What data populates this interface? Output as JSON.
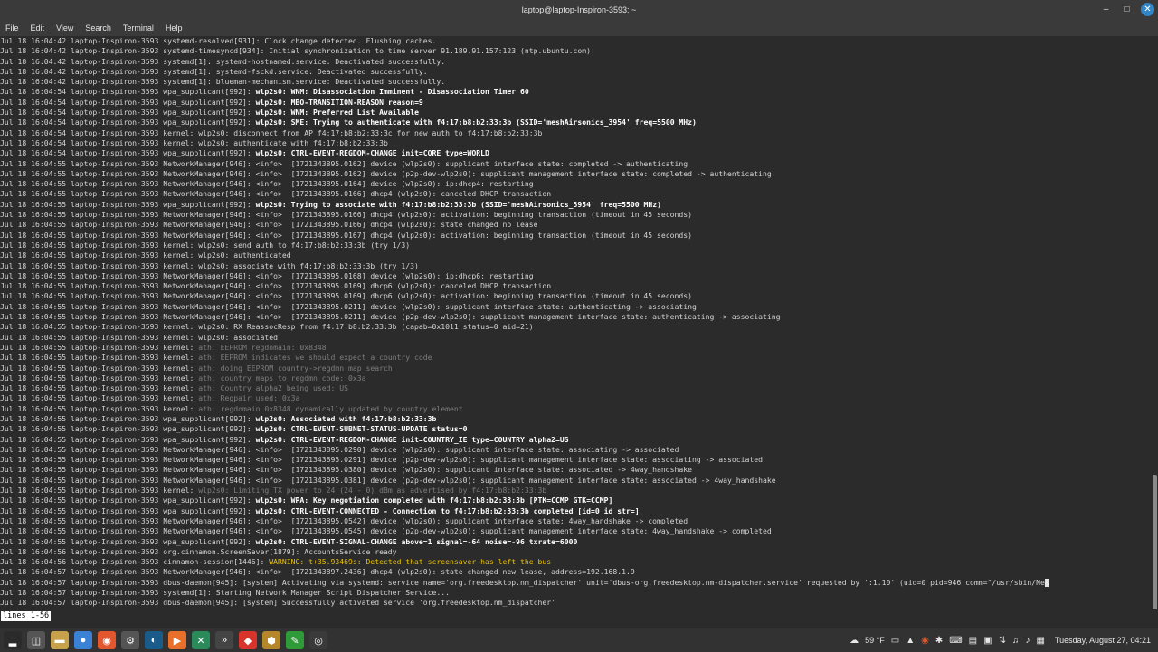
{
  "window": {
    "title": "laptop@laptop-Inspiron-3593: ~",
    "minimize_icon": "minimize-icon",
    "maximize_icon": "maximize-icon",
    "close_icon": "close-icon"
  },
  "menu": [
    "File",
    "Edit",
    "View",
    "Search",
    "Terminal",
    "Help"
  ],
  "terminal": {
    "lines": [
      [
        "Jul 18 16:04:42 laptop-Inspiron-3593 systemd-resolved[931]: Clock change detected. Flushing caches.",
        "n"
      ],
      [
        "Jul 18 16:04:42 laptop-Inspiron-3593 systemd-timesyncd[934]: Initial synchronization to time server 91.189.91.157:123 (ntp.ubuntu.com).",
        "n"
      ],
      [
        "Jul 18 16:04:42 laptop-Inspiron-3593 systemd[1]: systemd-hostnamed.service: Deactivated successfully.",
        "n"
      ],
      [
        "Jul 18 16:04:42 laptop-Inspiron-3593 systemd[1]: systemd-fsckd.service: Deactivated successfully.",
        "n"
      ],
      [
        "Jul 18 16:04:42 laptop-Inspiron-3593 systemd[1]: blueman-mechanism.service: Deactivated successfully.",
        "n"
      ],
      [
        "Jul 18 16:04:54 laptop-Inspiron-3593 wpa_supplicant[992]: |wlp2s0: WNM: Disassociation Imminent - Disassociation Timer 60",
        "b"
      ],
      [
        "Jul 18 16:04:54 laptop-Inspiron-3593 wpa_supplicant[992]: |wlp2s0: MBO-TRANSITION-REASON reason=9",
        "b"
      ],
      [
        "Jul 18 16:04:54 laptop-Inspiron-3593 wpa_supplicant[992]: |wlp2s0: WNM: Preferred List Available",
        "b"
      ],
      [
        "Jul 18 16:04:54 laptop-Inspiron-3593 wpa_supplicant[992]: |wlp2s0: SME: Trying to authenticate with f4:17:b8:b2:33:3b (SSID='meshAirsonics_3954' freq=5500 MHz)",
        "b"
      ],
      [
        "Jul 18 16:04:54 laptop-Inspiron-3593 kernel: wlp2s0: disconnect from AP f4:17:b8:b2:33:3c for new auth to f4:17:b8:b2:33:3b",
        "n"
      ],
      [
        "Jul 18 16:04:54 laptop-Inspiron-3593 kernel: wlp2s0: authenticate with f4:17:b8:b2:33:3b",
        "n"
      ],
      [
        "Jul 18 16:04:54 laptop-Inspiron-3593 wpa_supplicant[992]: |wlp2s0: CTRL-EVENT-REGDOM-CHANGE init=CORE type=WORLD",
        "b"
      ],
      [
        "Jul 18 16:04:55 laptop-Inspiron-3593 NetworkManager[946]: <info>  [1721343895.0162] device (wlp2s0): supplicant interface state: completed -> authenticating",
        "n"
      ],
      [
        "Jul 18 16:04:55 laptop-Inspiron-3593 NetworkManager[946]: <info>  [1721343895.0162] device (p2p-dev-wlp2s0): supplicant management interface state: completed -> authenticating",
        "n"
      ],
      [
        "Jul 18 16:04:55 laptop-Inspiron-3593 NetworkManager[946]: <info>  [1721343895.0164] device (wlp2s0): ip:dhcp4: restarting",
        "n"
      ],
      [
        "Jul 18 16:04:55 laptop-Inspiron-3593 NetworkManager[946]: <info>  [1721343895.0166] dhcp4 (wlp2s0): canceled DHCP transaction",
        "n"
      ],
      [
        "Jul 18 16:04:55 laptop-Inspiron-3593 wpa_supplicant[992]: |wlp2s0: Trying to associate with f4:17:b8:b2:33:3b (SSID='meshAirsonics_3954' freq=5500 MHz)",
        "b"
      ],
      [
        "Jul 18 16:04:55 laptop-Inspiron-3593 NetworkManager[946]: <info>  [1721343895.0166] dhcp4 (wlp2s0): activation: beginning transaction (timeout in 45 seconds)",
        "n"
      ],
      [
        "Jul 18 16:04:55 laptop-Inspiron-3593 NetworkManager[946]: <info>  [1721343895.0166] dhcp4 (wlp2s0): state changed no lease",
        "n"
      ],
      [
        "Jul 18 16:04:55 laptop-Inspiron-3593 NetworkManager[946]: <info>  [1721343895.0167] dhcp4 (wlp2s0): activation: beginning transaction (timeout in 45 seconds)",
        "n"
      ],
      [
        "Jul 18 16:04:55 laptop-Inspiron-3593 kernel: wlp2s0: send auth to f4:17:b8:b2:33:3b (try 1/3)",
        "n"
      ],
      [
        "Jul 18 16:04:55 laptop-Inspiron-3593 kernel: wlp2s0: authenticated",
        "n"
      ],
      [
        "Jul 18 16:04:55 laptop-Inspiron-3593 kernel: wlp2s0: associate with f4:17:b8:b2:33:3b (try 1/3)",
        "n"
      ],
      [
        "Jul 18 16:04:55 laptop-Inspiron-3593 NetworkManager[946]: <info>  [1721343895.0168] device (wlp2s0): ip:dhcp6: restarting",
        "n"
      ],
      [
        "Jul 18 16:04:55 laptop-Inspiron-3593 NetworkManager[946]: <info>  [1721343895.0169] dhcp6 (wlp2s0): canceled DHCP transaction",
        "n"
      ],
      [
        "Jul 18 16:04:55 laptop-Inspiron-3593 NetworkManager[946]: <info>  [1721343895.0169] dhcp6 (wlp2s0): activation: beginning transaction (timeout in 45 seconds)",
        "n"
      ],
      [
        "Jul 18 16:04:55 laptop-Inspiron-3593 NetworkManager[946]: <info>  [1721343895.0211] device (wlp2s0): supplicant interface state: authenticating -> associating",
        "n"
      ],
      [
        "Jul 18 16:04:55 laptop-Inspiron-3593 NetworkManager[946]: <info>  [1721343895.0211] device (p2p-dev-wlp2s0): supplicant management interface state: authenticating -> associating",
        "n"
      ],
      [
        "Jul 18 16:04:55 laptop-Inspiron-3593 kernel: wlp2s0: RX ReassocResp from f4:17:b8:b2:33:3b (capab=0x1011 status=0 aid=21)",
        "n"
      ],
      [
        "Jul 18 16:04:55 laptop-Inspiron-3593 kernel: wlp2s0: associated",
        "n"
      ],
      [
        "Jul 18 16:04:55 laptop-Inspiron-3593 kernel: |ath: EEPROM regdomain: 0x8348",
        "d"
      ],
      [
        "Jul 18 16:04:55 laptop-Inspiron-3593 kernel: |ath: EEPROM indicates we should expect a country code",
        "d"
      ],
      [
        "Jul 18 16:04:55 laptop-Inspiron-3593 kernel: |ath: doing EEPROM country->regdmn map search",
        "d"
      ],
      [
        "Jul 18 16:04:55 laptop-Inspiron-3593 kernel: |ath: country maps to regdmn code: 0x3a",
        "d"
      ],
      [
        "Jul 18 16:04:55 laptop-Inspiron-3593 kernel: |ath: Country alpha2 being used: US",
        "d"
      ],
      [
        "Jul 18 16:04:55 laptop-Inspiron-3593 kernel: |ath: Regpair used: 0x3a",
        "d"
      ],
      [
        "Jul 18 16:04:55 laptop-Inspiron-3593 kernel: |ath: regdomain 0x8348 dynamically updated by country element",
        "d"
      ],
      [
        "Jul 18 16:04:55 laptop-Inspiron-3593 wpa_supplicant[992]: |wlp2s0: Associated with f4:17:b8:b2:33:3b",
        "b"
      ],
      [
        "Jul 18 16:04:55 laptop-Inspiron-3593 wpa_supplicant[992]: |wlp2s0: CTRL-EVENT-SUBNET-STATUS-UPDATE status=0",
        "b"
      ],
      [
        "Jul 18 16:04:55 laptop-Inspiron-3593 wpa_supplicant[992]: |wlp2s0: CTRL-EVENT-REGDOM-CHANGE init=COUNTRY_IE type=COUNTRY alpha2=US",
        "b"
      ],
      [
        "Jul 18 16:04:55 laptop-Inspiron-3593 NetworkManager[946]: <info>  [1721343895.0290] device (wlp2s0): supplicant interface state: associating -> associated",
        "n"
      ],
      [
        "Jul 18 16:04:55 laptop-Inspiron-3593 NetworkManager[946]: <info>  [1721343895.0291] device (p2p-dev-wlp2s0): supplicant management interface state: associating -> associated",
        "n"
      ],
      [
        "Jul 18 16:04:55 laptop-Inspiron-3593 NetworkManager[946]: <info>  [1721343895.0380] device (wlp2s0): supplicant interface state: associated -> 4way_handshake",
        "n"
      ],
      [
        "Jul 18 16:04:55 laptop-Inspiron-3593 NetworkManager[946]: <info>  [1721343895.0381] device (p2p-dev-wlp2s0): supplicant management interface state: associated -> 4way_handshake",
        "n"
      ],
      [
        "Jul 18 16:04:55 laptop-Inspiron-3593 kernel: |wlp2s0: Limiting TX power to 24 (24 - 0) dBm as advertised by f4:17:b8:b2:33:3b",
        "d"
      ],
      [
        "Jul 18 16:04:55 laptop-Inspiron-3593 wpa_supplicant[992]: |wlp2s0: WPA: Key negotiation completed with f4:17:b8:b2:33:3b [PTK=CCMP GTK=CCMP]",
        "b"
      ],
      [
        "Jul 18 16:04:55 laptop-Inspiron-3593 wpa_supplicant[992]: |wlp2s0: CTRL-EVENT-CONNECTED - Connection to f4:17:b8:b2:33:3b completed [id=0 id_str=]",
        "b"
      ],
      [
        "Jul 18 16:04:55 laptop-Inspiron-3593 NetworkManager[946]: <info>  [1721343895.0542] device (wlp2s0): supplicant interface state: 4way_handshake -> completed",
        "n"
      ],
      [
        "Jul 18 16:04:55 laptop-Inspiron-3593 NetworkManager[946]: <info>  [1721343895.0545] device (p2p-dev-wlp2s0): supplicant management interface state: 4way_handshake -> completed",
        "n"
      ],
      [
        "Jul 18 16:04:55 laptop-Inspiron-3593 wpa_supplicant[992]: |wlp2s0: CTRL-EVENT-SIGNAL-CHANGE above=1 signal=-64 noise=-96 txrate=6000",
        "b"
      ],
      [
        "Jul 18 16:04:56 laptop-Inspiron-3593 org.cinnamon.ScreenSaver[1879]: AccountsService ready",
        "n"
      ],
      [
        "Jul 18 16:04:56 laptop-Inspiron-3593 cinnamon-session[1446]: |WARNING: t+35.93469s: Detected that screensaver has left the bus",
        "w"
      ],
      [
        "Jul 18 16:04:57 laptop-Inspiron-3593 NetworkManager[946]: <info>  [1721343897.2436] dhcp4 (wlp2s0): state changed new lease, address=192.168.1.9",
        "n"
      ],
      [
        "Jul 18 16:04:57 laptop-Inspiron-3593 dbus-daemon[945]: [system] Activating via systemd: service name='org.freedesktop.nm_dispatcher' unit='dbus-org.freedesktop.nm-dispatcher.service' requested by ':1.10' (uid=0 pid=946 comm=\"/usr/sbin/Ne",
        "c"
      ],
      [
        "Jul 18 16:04:57 laptop-Inspiron-3593 systemd[1]: Starting Network Manager Script Dispatcher Service...",
        "n"
      ],
      [
        "Jul 18 16:04:57 laptop-Inspiron-3593 dbus-daemon[945]: [system] Successfully activated service 'org.freedesktop.nm_dispatcher'",
        "n"
      ]
    ],
    "status": "lines 1-56"
  },
  "panel": {
    "launchers": [
      {
        "name": "menu-icon",
        "color": "#2b2b2b",
        "glyph": "▂"
      },
      {
        "name": "show-desktop-icon",
        "color": "#555555",
        "glyph": "◫"
      },
      {
        "name": "files-icon",
        "color": "#c8a24a",
        "glyph": "▬"
      },
      {
        "name": "chrome-icon",
        "color": "#3b82d6",
        "glyph": "●"
      },
      {
        "name": "firefox-icon",
        "color": "#e4572e",
        "glyph": "◉"
      },
      {
        "name": "settings-icon",
        "color": "#555555",
        "glyph": "⚙"
      },
      {
        "name": "steam-icon",
        "color": "#1b5b8a",
        "glyph": "◐"
      },
      {
        "name": "media-player-icon",
        "color": "#e8702a",
        "glyph": "▶"
      },
      {
        "name": "vpn-icon",
        "color": "#2a8a5a",
        "glyph": "✕"
      },
      {
        "name": "terminal-app-icon",
        "color": "#444444",
        "glyph": "»"
      },
      {
        "name": "anydesk-icon",
        "color": "#d9342b",
        "glyph": "◆"
      },
      {
        "name": "bag-icon",
        "color": "#b5862a",
        "glyph": "⬢"
      },
      {
        "name": "pen-icon",
        "color": "#2f9a3a",
        "glyph": "✎"
      },
      {
        "name": "timeshift-icon",
        "color": "#3a3a3a",
        "glyph": "◎"
      }
    ],
    "weather": "59 °F",
    "clock": "Tuesday, August 27, 04:21",
    "tray_icons": [
      "trash-icon",
      "update-icon",
      "brave-icon",
      "bluetooth-icon",
      "keyboard-icon",
      "clipboard-icon",
      "display-icon",
      "network-icon",
      "music-icon",
      "volume-icon",
      "calendar-icon"
    ]
  }
}
